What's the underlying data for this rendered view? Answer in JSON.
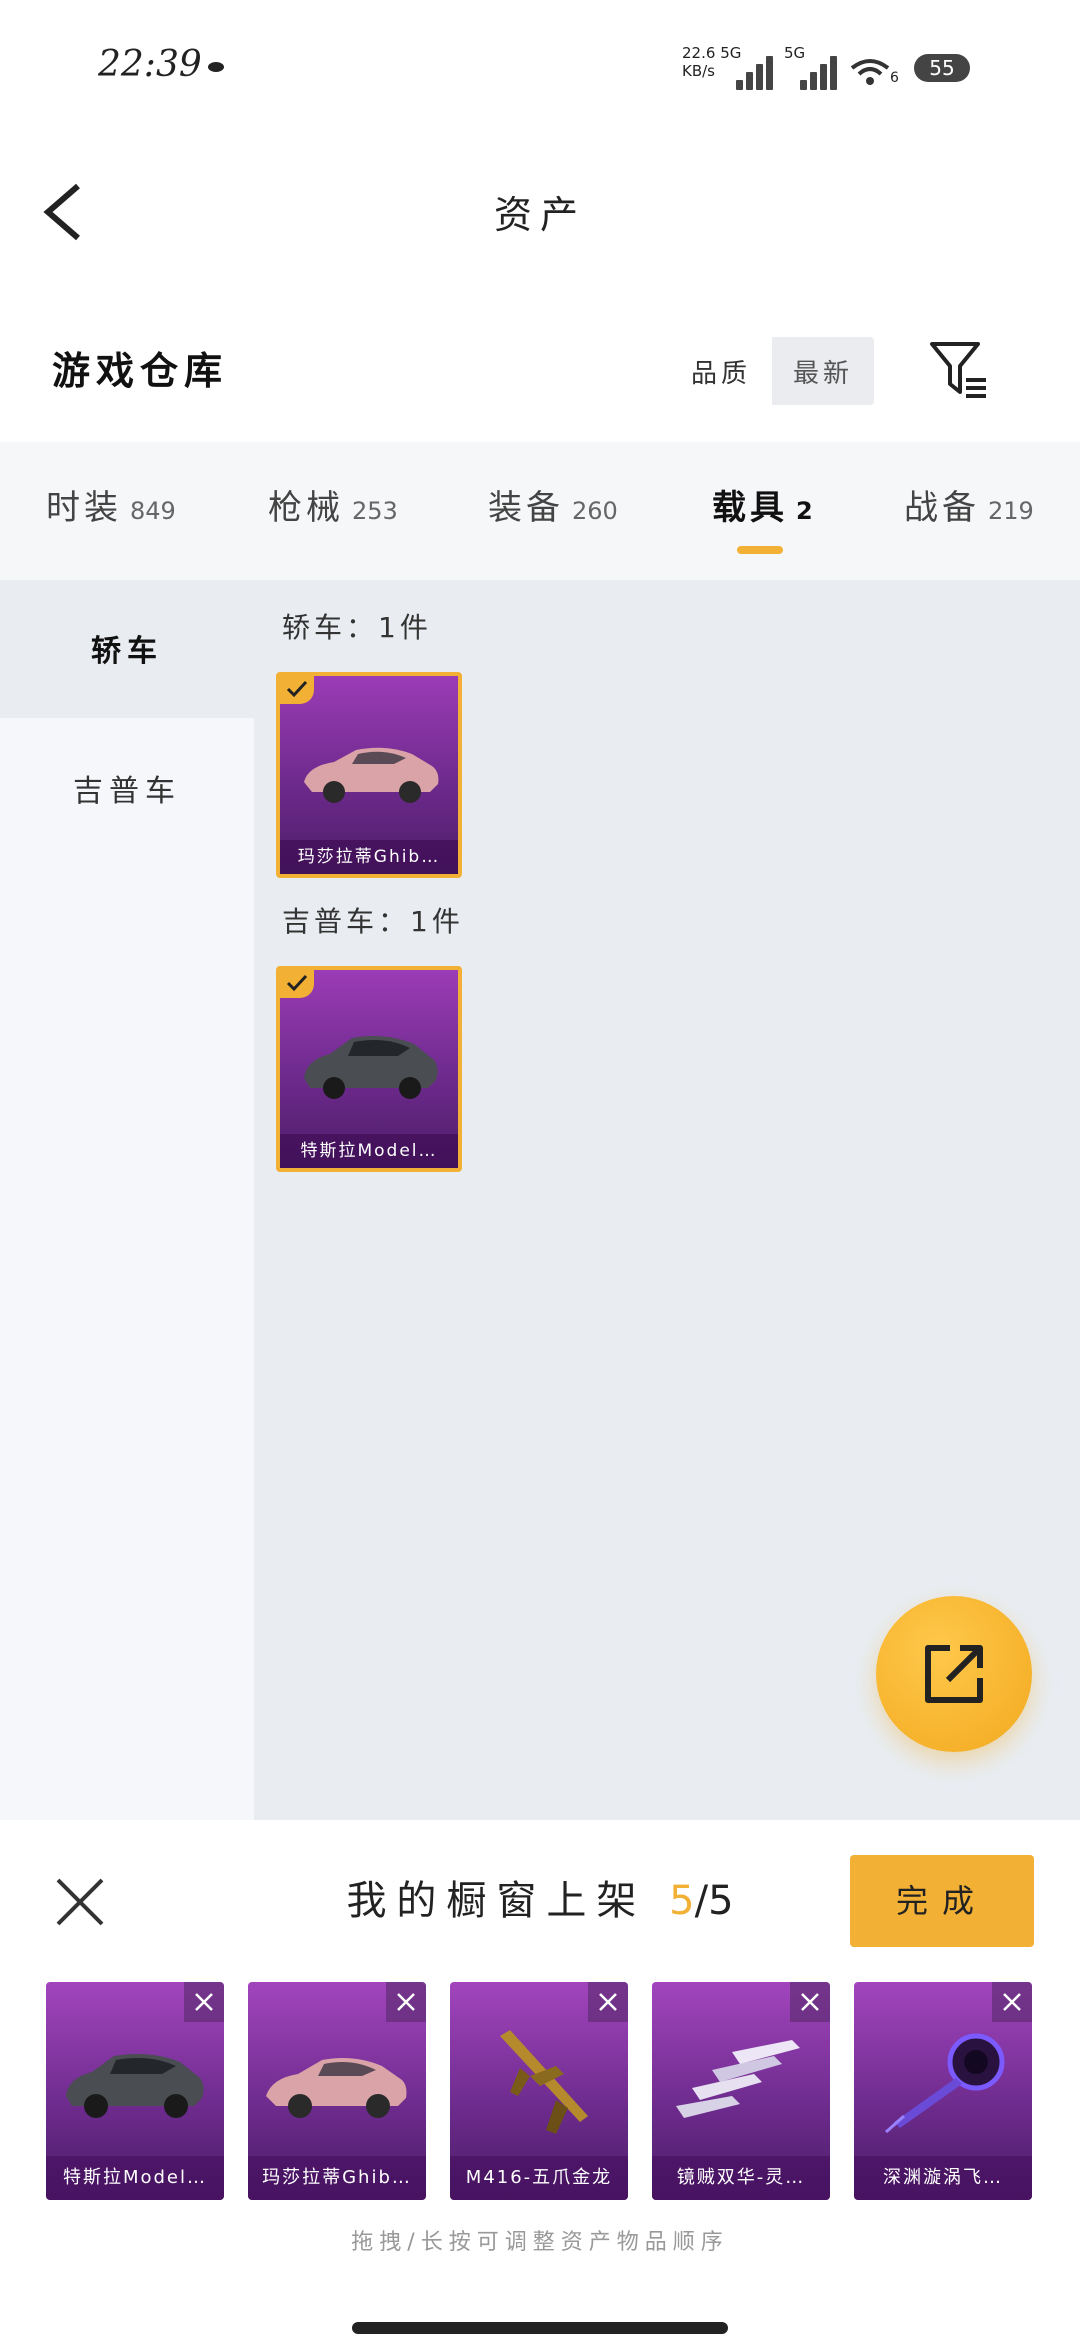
{
  "status_bar": {
    "time": "22:39",
    "net_speed_value": "22.6",
    "net_speed_unit": "KB/s",
    "net_type_1": "5G",
    "net_type_2": "5G",
    "wifi_index": "6",
    "battery": "55"
  },
  "header": {
    "title": "资产"
  },
  "warehouse": {
    "title": "游戏仓库",
    "sort_options": [
      "品质",
      "最新"
    ]
  },
  "tabs": [
    {
      "label": "时装",
      "count": "849"
    },
    {
      "label": "枪械",
      "count": "253"
    },
    {
      "label": "装备",
      "count": "260"
    },
    {
      "label": "载具",
      "count": "2"
    },
    {
      "label": "战备",
      "count": "219"
    }
  ],
  "active_tab": "载具",
  "sidebar": {
    "items": [
      "轿车",
      "吉普车"
    ]
  },
  "groups": [
    {
      "label": "轿车：1件",
      "items": [
        {
          "name": "玛莎拉蒂Ghib…",
          "selected": true
        }
      ]
    },
    {
      "label": "吉普车：1件",
      "items": [
        {
          "name": "特斯拉Model…",
          "selected": true
        }
      ]
    }
  ],
  "showcase": {
    "title": "我的橱窗上架",
    "current": "5",
    "separator": "/",
    "total": "5",
    "done_label": "完成",
    "items": [
      {
        "name": "特斯拉Model…",
        "icon": "car-dark-icon"
      },
      {
        "name": "玛莎拉蒂Ghib…",
        "icon": "car-pink-icon"
      },
      {
        "name": "M416-五爪金龙",
        "icon": "rifle-icon"
      },
      {
        "name": "镜贼双华-灵…",
        "icon": "crystal-blades-icon"
      },
      {
        "name": "深渊漩涡飞…",
        "icon": "vortex-glider-icon"
      }
    ],
    "hint": "拖拽/长按可调整资产物品顺序"
  },
  "colors": {
    "accent": "#f2b035",
    "card_purple": "#7a2f9c"
  }
}
